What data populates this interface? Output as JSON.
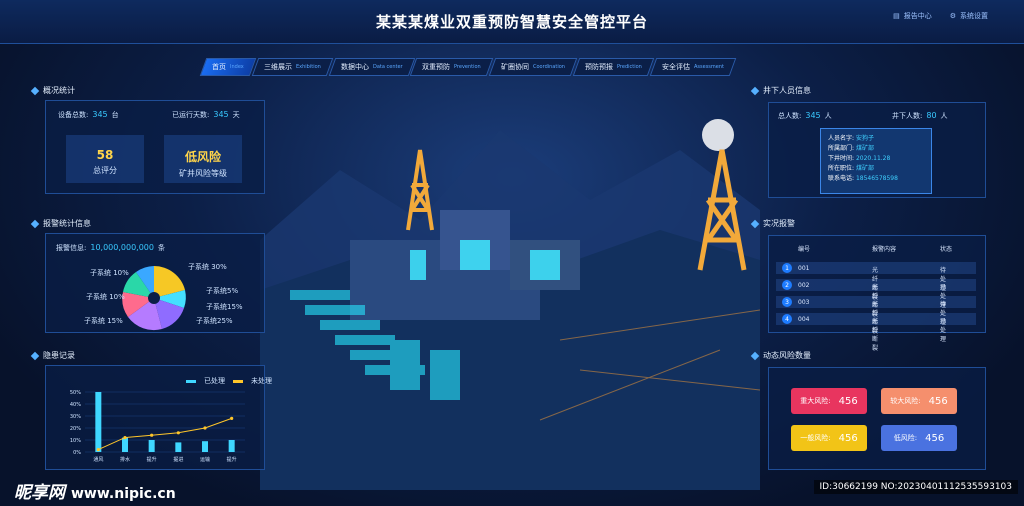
{
  "header": {
    "title": "某某某煤业双重预防智慧安全管控平台",
    "links": [
      {
        "label": "报告中心"
      },
      {
        "label": "系统设置"
      }
    ]
  },
  "tabs": [
    {
      "label": "首页",
      "en": "Index",
      "active": true
    },
    {
      "label": "三维展示",
      "en": "Exhibition"
    },
    {
      "label": "数据中心",
      "en": "Data center"
    },
    {
      "label": "双重预防",
      "en": "Prevention"
    },
    {
      "label": "矿圈协同",
      "en": "Coordination"
    },
    {
      "label": "预防预报",
      "en": "Prediction"
    },
    {
      "label": "安全评估",
      "en": "Assessment"
    }
  ],
  "overview": {
    "title": "概况统计",
    "device_label": "设备总数:",
    "device_value": "345",
    "device_unit": "台",
    "days_label": "已运行天数:",
    "days_value": "345",
    "days_unit": "天",
    "score_value": "58",
    "score_label": "总评分",
    "risk_value": "低风险",
    "risk_label": "矿井风险等级"
  },
  "alarm_stats": {
    "title": "报警统计信息",
    "info_label": "报警信息:",
    "info_value": "10,000,000,000",
    "info_unit": "条",
    "labels": [
      "子系统 30%",
      "子系统5%",
      "子系统15%",
      "子系统25%",
      "子系统 15%",
      "子系统 10%",
      "子系统 10%"
    ]
  },
  "hazard": {
    "title": "隐患记录",
    "legend": [
      "已处理",
      "未处理"
    ],
    "chart_data": {
      "type": "bar",
      "categories": [
        "通风",
        "排水",
        "提升",
        "掘进",
        "运输",
        "提升"
      ],
      "series": [
        {
          "name": "已处理",
          "values": [
            50,
            12,
            10,
            8,
            9,
            10
          ]
        },
        {
          "name": "未处理",
          "values": [
            2,
            12,
            14,
            16,
            20,
            28
          ]
        }
      ],
      "ylim": [
        0,
        50
      ],
      "yticks": [
        "50%",
        "40%",
        "30%",
        "20%",
        "10%",
        "0%"
      ],
      "colors": {
        "bar": "#3fd7ff",
        "line": "#ffc62a"
      }
    }
  },
  "personnel": {
    "title": "井下人员信息",
    "total_label": "总人数:",
    "total_value": "345",
    "total_unit": "人",
    "down_label": "井下人数:",
    "down_value": "80",
    "down_unit": "人",
    "popup": [
      {
        "label": "人员名字:",
        "value": "安狗子"
      },
      {
        "label": "所属部门:",
        "value": "煤矿部"
      },
      {
        "label": "下井时间:",
        "value": "2020.11.28"
      },
      {
        "label": "所在职位:",
        "value": "煤矿部"
      },
      {
        "label": "联系电话:",
        "value": "18546578598"
      }
    ]
  },
  "realtime_alarm": {
    "title": "实况报警",
    "columns": [
      "编号",
      "报警内容",
      "状态"
    ],
    "rows": [
      {
        "idx": "1",
        "id": "001",
        "content": "光纤断裂",
        "status": "待处理"
      },
      {
        "idx": "2",
        "id": "002",
        "content": "光纤断裂",
        "status": "已处理"
      },
      {
        "idx": "3",
        "id": "003",
        "content": "光纤断裂",
        "status": "待处理"
      },
      {
        "idx": "4",
        "id": "004",
        "content": "光纤断裂",
        "status": "已处理"
      }
    ]
  },
  "dynamic_risk": {
    "title": "动态风险数量",
    "items": [
      {
        "label": "重大风险:",
        "value": "456",
        "color": "#e8355f"
      },
      {
        "label": "较大风险:",
        "value": "456",
        "color": "#f58f6d"
      },
      {
        "label": "一般风险:",
        "value": "456",
        "color": "#f2c417"
      },
      {
        "label": "低风险:",
        "value": "456",
        "color": "#4a72e0"
      }
    ]
  },
  "watermark": {
    "brand": "昵享网",
    "site": "www.nipic.cn",
    "id": "ID:30662199 NO:20230401112535593103"
  }
}
